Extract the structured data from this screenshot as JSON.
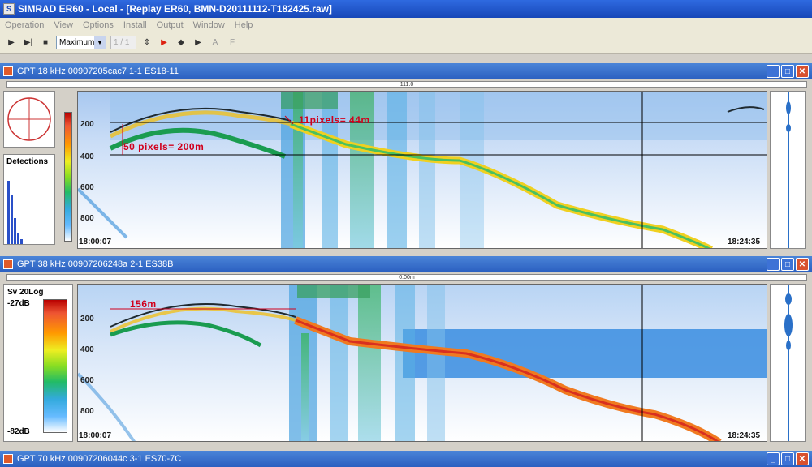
{
  "app": {
    "title": "SIMRAD ER60 - Local - [Replay ER60, BMN-D20111112-T182425.raw]",
    "logo_icon": "simrad-icon"
  },
  "menu": [
    "Operation",
    "View",
    "Options",
    "Install",
    "Output",
    "Window",
    "Help"
  ],
  "toolbar": {
    "mode_select": "Maximum",
    "spin_value": "1 / 1",
    "icons": [
      "play-icon",
      "step-icon",
      "pause-icon",
      "record-icon",
      "rewind-icon",
      "forward-icon",
      "a-icon",
      "f-icon"
    ]
  },
  "panels": [
    {
      "title": "GPT  18 kHz 00907205cac7 1-1 ES18-11",
      "ruler_label": "111.0",
      "detections_label": "Detections",
      "depth_ticks": [
        "200",
        "400",
        "600",
        "800"
      ],
      "time_start": "18:00:07",
      "time_end": "18:24:35",
      "annotations": [
        "11pixels= 44m",
        "50 pixels= 200m"
      ]
    },
    {
      "title": "GPT  38 kHz 00907206248a 2-1 ES38B",
      "ruler_label": "0.00m",
      "colorbar_title": "Sv 20Log",
      "colorbar_max": "-27dB",
      "colorbar_min": "-82dB",
      "depth_ticks": [
        "200",
        "400",
        "600",
        "800"
      ],
      "time_start": "18:00:07",
      "time_end": "18:24:35",
      "annotations": [
        "156m"
      ]
    },
    {
      "title": "GPT  70 kHz 00907206044c 3-1 ES70-7C"
    }
  ],
  "colors": {
    "title_bar": "#1747b8",
    "annotation": "#d1001c",
    "echo_bottom": "#f0c020",
    "echo_water": "#3a8de0"
  }
}
